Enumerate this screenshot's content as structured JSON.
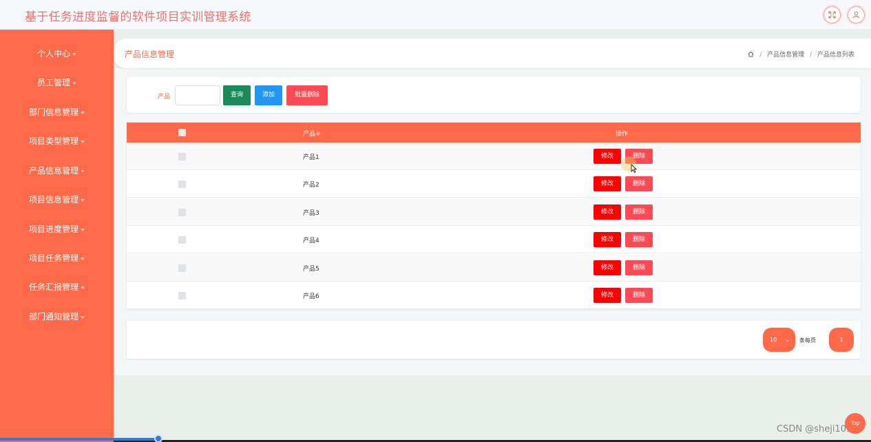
{
  "app": {
    "title": "基于任务进度监督的软件项目实训管理系统"
  },
  "header": {
    "fullscreen_icon": "expand-arrows-icon",
    "user_icon": "user-icon"
  },
  "sidebar": {
    "items": [
      {
        "label": "个人中心"
      },
      {
        "label": "员工管理"
      },
      {
        "label": "部门信息管理"
      },
      {
        "label": "项目类型管理"
      },
      {
        "label": "产品信息管理"
      },
      {
        "label": "项目信息管理"
      },
      {
        "label": "项目进度管理"
      },
      {
        "label": "项目任务管理"
      },
      {
        "label": "任务汇报管理"
      },
      {
        "label": "部门通知管理"
      }
    ]
  },
  "page": {
    "title": "产品信息管理",
    "breadcrumb": {
      "home_icon": "home-icon",
      "level1": "产品信息管理",
      "sep": "/",
      "level2": "产品信息列表"
    }
  },
  "search": {
    "label": "产品",
    "input_value": "",
    "query_label": "查询",
    "add_label": "添加",
    "batch_delete_label": "批量删除"
  },
  "table": {
    "headers": {
      "name": "产品≑",
      "ops": "操作"
    },
    "rows": [
      {
        "name": "产品1",
        "edit": "修改",
        "delete": "删除"
      },
      {
        "name": "产品2",
        "edit": "修改",
        "delete": "删除"
      },
      {
        "name": "产品3",
        "edit": "修改",
        "delete": "删除"
      },
      {
        "name": "产品4",
        "edit": "修改",
        "delete": "删除"
      },
      {
        "name": "产品5",
        "edit": "修改",
        "delete": "删除"
      },
      {
        "name": "产品6",
        "edit": "修改",
        "delete": "删除"
      }
    ]
  },
  "pagination": {
    "page_size": "10",
    "per_page_label": "条每页",
    "current_page": "1"
  },
  "footer": {
    "watermark": "CSDN @sheji1011",
    "top_label": "Top"
  },
  "colors": {
    "accent": "#ff6b4a",
    "title": "#f0726a",
    "edit": "#ff0000",
    "delete": "#ff4a55",
    "query": "#1b8a5a",
    "add": "#2196f3"
  }
}
